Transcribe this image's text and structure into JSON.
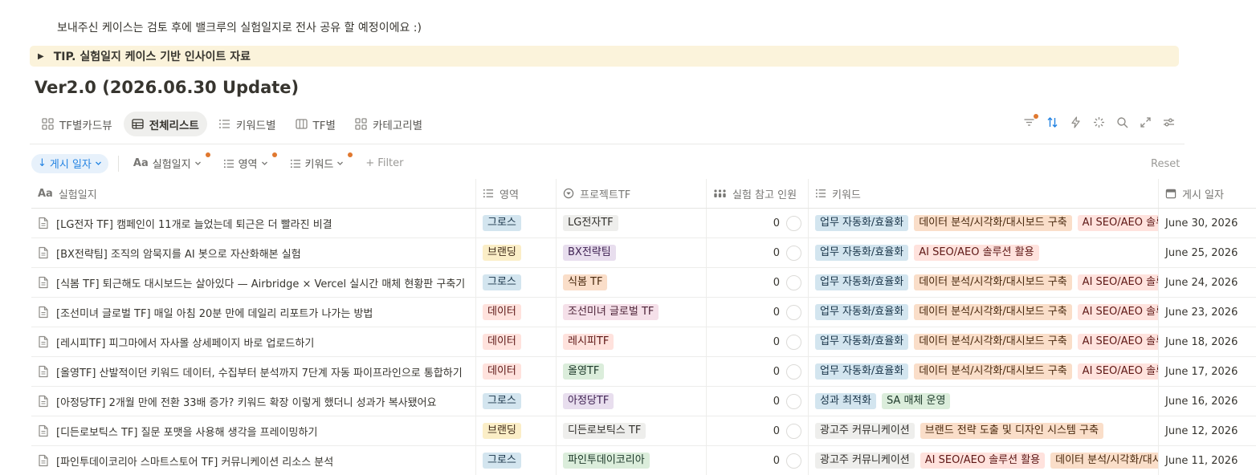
{
  "intro_text": "보내주신 케이스는 검토 후에 밸크루의 실험일지로 전사 공유 할 예정이에요 :)",
  "callout": {
    "arrow": "▶",
    "text": "TIP. 실험일지 케이스 기반 인사이트 자료"
  },
  "page_title": "Ver2.0 (2026.06.30 Update)",
  "views": [
    {
      "label": "TF별카드뷰",
      "icon": "gallery-icon",
      "active": false
    },
    {
      "label": "전체리스트",
      "icon": "table-icon",
      "active": true
    },
    {
      "label": "키워드별",
      "icon": "list-icon",
      "active": false
    },
    {
      "label": "TF별",
      "icon": "board-icon",
      "active": false
    },
    {
      "label": "카테고리별",
      "icon": "gallery-icon",
      "active": false
    }
  ],
  "filters": {
    "sort_label": "게시 일자",
    "chips": [
      "실험일지",
      "영역",
      "키워드"
    ],
    "add_filter": "Filter",
    "reset": "Reset"
  },
  "columns": [
    "실험일지",
    "영역",
    "프로젝트TF",
    "실험 참고 인원",
    "키워드",
    "게시 일자"
  ],
  "colors": {
    "accent": "#2383e2",
    "indicator": "#e0782f",
    "callout_bg": "#fbf3db"
  },
  "tag_styles": {
    "그로스": {
      "bg": "#d3e5ef",
      "fg": "#183347"
    },
    "브랜딩": {
      "bg": "#fbeec7",
      "fg": "#402c1b"
    },
    "데이터": {
      "bg": "#ffe2dd",
      "fg": "#5d1715"
    },
    "LG전자TF": {
      "bg": "#eeeeec",
      "fg": "#32302c"
    },
    "BX전략팀": {
      "bg": "#e8deee",
      "fg": "#412454"
    },
    "식봄 TF": {
      "bg": "#fadec9",
      "fg": "#49290e"
    },
    "조선미녀 글로벌 TF": {
      "bg": "#f5e0e9",
      "fg": "#4c2337"
    },
    "레시피TF": {
      "bg": "#ffe2dd",
      "fg": "#5d1715"
    },
    "올영TF": {
      "bg": "#dbeddb",
      "fg": "#1c3829"
    },
    "아정당TF": {
      "bg": "#e8deee",
      "fg": "#412454"
    },
    "디든로보틱스 TF": {
      "bg": "#eeeeec",
      "fg": "#32302c"
    },
    "파인투데이코리아": {
      "bg": "#dbeddb",
      "fg": "#1c3829"
    },
    "업무 자동화/효율화": {
      "bg": "#d3e5ef",
      "fg": "#183347"
    },
    "데이터 분석/시각화/대시보드 구축": {
      "bg": "#fadec9",
      "fg": "#49290e"
    },
    "AI SEO/AEO 솔루션 활용": {
      "bg": "#ffe2dd",
      "fg": "#5d1715"
    },
    "성과 최적화": {
      "bg": "#d3e5ef",
      "fg": "#183347"
    },
    "SA 매체 운영": {
      "bg": "#dbeddb",
      "fg": "#1c3829"
    },
    "광고주 커뮤니케이션": {
      "bg": "#eeeeec",
      "fg": "#32302c"
    },
    "브랜드 전략 도출 및 디자인 시스템 구축": {
      "bg": "#fadec9",
      "fg": "#49290e"
    }
  },
  "rows": [
    {
      "title": "[LG전자 TF] 캠페인이 11개로 늘었는데 퇴근은 더 빨라진 비결",
      "area": "그로스",
      "tf": "LG전자TF",
      "people": "0",
      "keywords": [
        "업무 자동화/효율화",
        "데이터 분석/시각화/대시보드 구축",
        "AI SEO/AEO 솔루션 활용"
      ],
      "date": "June 30, 2026"
    },
    {
      "title": "[BX전략팀] 조직의 암묵지를 AI 봇으로 자산화해본 실험",
      "area": "브랜딩",
      "tf": "BX전략팀",
      "people": "0",
      "keywords": [
        "업무 자동화/효율화",
        "AI SEO/AEO 솔루션 활용"
      ],
      "date": "June 25, 2026"
    },
    {
      "title": "[식봄 TF] 퇴근해도 대시보드는 살아있다 — Airbridge × Vercel 실시간 매체 현황판 구축기",
      "area": "그로스",
      "tf": "식봄 TF",
      "people": "0",
      "keywords": [
        "업무 자동화/효율화",
        "데이터 분석/시각화/대시보드 구축",
        "AI SEO/AEO 솔루션 활용"
      ],
      "date": "June 24, 2026"
    },
    {
      "title": "[조선미녀 글로벌 TF] 매일 아침 20분 만에 데일리 리포트가 나가는 방법",
      "area": "데이터",
      "tf": "조선미녀 글로벌 TF",
      "people": "0",
      "keywords": [
        "업무 자동화/효율화",
        "데이터 분석/시각화/대시보드 구축",
        "AI SEO/AEO 솔루션 활용"
      ],
      "date": "June 23, 2026"
    },
    {
      "title": "[레시피TF] 피그마에서 자사몰 상세페이지 바로 업로드하기",
      "area": "데이터",
      "tf": "레시피TF",
      "people": "0",
      "keywords": [
        "업무 자동화/효율화",
        "데이터 분석/시각화/대시보드 구축",
        "AI SEO/AEO 솔루션 활용"
      ],
      "date": "June 18, 2026"
    },
    {
      "title": "[올영TF] 산발적이던 키워드 데이터, 수집부터 분석까지 7단계 자동 파이프라인으로 통합하기",
      "area": "데이터",
      "tf": "올영TF",
      "people": "0",
      "keywords": [
        "업무 자동화/효율화",
        "데이터 분석/시각화/대시보드 구축",
        "AI SEO/AEO 솔루션 활용"
      ],
      "date": "June 17, 2026"
    },
    {
      "title": "[아정당TF] 2개월 만에 전환 33배 증가? 키워드 확장 이렇게 했더니 성과가 복사됐어요",
      "area": "그로스",
      "tf": "아정당TF",
      "people": "0",
      "keywords": [
        "성과 최적화",
        "SA 매체 운영"
      ],
      "date": "June 16, 2026"
    },
    {
      "title": "[디든로보틱스 TF] 질문 포맷을 사용해 생각을 프레이밍하기",
      "area": "브랜딩",
      "tf": "디든로보틱스 TF",
      "people": "0",
      "keywords": [
        "광고주 커뮤니케이션",
        "브랜드 전략 도출 및 디자인 시스템 구축"
      ],
      "date": "June 12, 2026"
    },
    {
      "title": "[파인투데이코리아 스마트스토어 TF] 커뮤니케이션 리소스 분석",
      "area": "그로스",
      "tf": "파인투데이코리아",
      "people": "0",
      "keywords": [
        "광고주 커뮤니케이션",
        "AI SEO/AEO 솔루션 활용",
        "데이터 분석/시각화/대시보드 구축"
      ],
      "date": "June 11, 2026"
    }
  ]
}
